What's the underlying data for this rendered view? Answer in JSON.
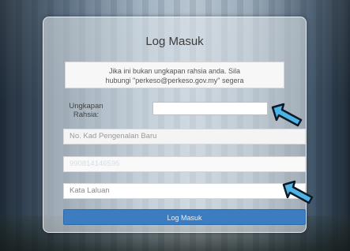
{
  "form": {
    "title": "Log Masuk",
    "notice_line1": "Jika ini bukan ungkapan rahsia anda. Sila",
    "notice_line2": "hubungi \"perkeso@perkeso.gov.my\" segera",
    "passphrase_label_line1": "Ungkapan",
    "passphrase_label_line2": "Rahsia:",
    "passphrase_value": "",
    "ic_placeholder": "No. Kad Pengenalan Baru",
    "ic_value": "990814146595",
    "password_placeholder": "Kata Laluan",
    "submit_label": "Log Masuk"
  },
  "annotations": {
    "arrow_color": "#4db4e8"
  }
}
